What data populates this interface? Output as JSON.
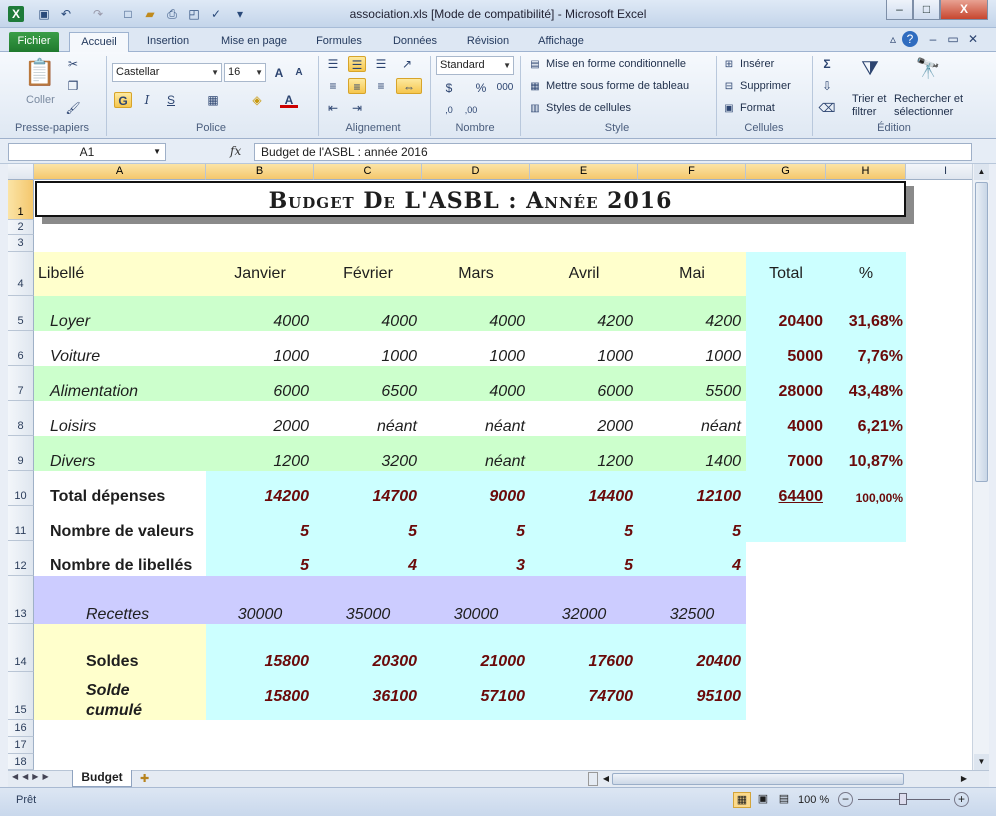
{
  "window": {
    "title": "association.xls  [Mode de compatibilité]  -  Microsoft Excel",
    "app_icon": "X",
    "minimize": "–",
    "restore": "□",
    "close": "X"
  },
  "ribbon_tabs": [
    "Fichier",
    "Accueil",
    "Insertion",
    "Mise en page",
    "Formules",
    "Données",
    "Révision",
    "Affichage"
  ],
  "ribbon": {
    "clipboard": {
      "paste": "Coller",
      "label": "Presse-papiers"
    },
    "font": {
      "name": "Castellar",
      "size": "16",
      "bold": "G",
      "italic": "I",
      "underline": "S",
      "label": "Police"
    },
    "alignment": {
      "label": "Alignement"
    },
    "number": {
      "format": "Standard",
      "currency": "$",
      "percent": "%",
      "thousands": "000",
      "label": "Nombre"
    },
    "style": {
      "conditional": "Mise en forme conditionnelle",
      "table": "Mettre sous forme de tableau",
      "cell_styles": "Styles de cellules",
      "label": "Style"
    },
    "cells": {
      "insert": "Insérer",
      "delete": "Supprimer",
      "format": "Format",
      "label": "Cellules"
    },
    "editing": {
      "sigma": "Σ",
      "sort_line1": "Trier et",
      "sort_line2": "filtrer",
      "find_line1": "Rechercher et",
      "find_line2": "sélectionner",
      "label": "Édition"
    }
  },
  "formula_bar": {
    "name_box": "A1",
    "fx": "fx",
    "content": "Budget de l'ASBL : année 2016"
  },
  "columns": [
    "A",
    "B",
    "C",
    "D",
    "E",
    "F",
    "G",
    "H",
    "I"
  ],
  "rows": [
    "1",
    "2",
    "3",
    "4",
    "5",
    "6",
    "7",
    "8",
    "9",
    "10",
    "11",
    "12",
    "13",
    "14",
    "15",
    "16",
    "17",
    "18"
  ],
  "sheet": {
    "title": "Budget de l'ASBL : année 2016",
    "header": {
      "label": "Libellé",
      "months": [
        "Janvier",
        "Février",
        "Mars",
        "Avril",
        "Mai"
      ],
      "total": "Total",
      "pct": "%"
    },
    "expenses": [
      {
        "label": "Loyer",
        "values": [
          "4000",
          "4000",
          "4000",
          "4200",
          "4200"
        ],
        "total": "20400",
        "pct": "31,68%"
      },
      {
        "label": "Voiture",
        "values": [
          "1000",
          "1000",
          "1000",
          "1000",
          "1000"
        ],
        "total": "5000",
        "pct": "7,76%"
      },
      {
        "label": "Alimentation",
        "values": [
          "6000",
          "6500",
          "4000",
          "6000",
          "5500"
        ],
        "total": "28000",
        "pct": "43,48%"
      },
      {
        "label": "Loisirs",
        "values": [
          "2000",
          "néant",
          "néant",
          "2000",
          "néant"
        ],
        "total": "4000",
        "pct": "6,21%"
      },
      {
        "label": "Divers",
        "values": [
          "1200",
          "3200",
          "néant",
          "1200",
          "1400"
        ],
        "total": "7000",
        "pct": "10,87%"
      }
    ],
    "total_depenses": {
      "label": "Total dépenses",
      "values": [
        "14200",
        "14700",
        "9000",
        "14400",
        "12100"
      ],
      "total": "64400",
      "pct": "100,00%"
    },
    "nb_valeurs": {
      "label": "Nombre de valeurs",
      "values": [
        "5",
        "5",
        "5",
        "5",
        "5"
      ]
    },
    "nb_libelles": {
      "label": "Nombre de libellés",
      "values": [
        "5",
        "4",
        "3",
        "5",
        "4"
      ]
    },
    "recettes": {
      "label": "Recettes",
      "values": [
        "30000",
        "35000",
        "30000",
        "32000",
        "32500"
      ]
    },
    "soldes": {
      "label": "Soldes",
      "values": [
        "15800",
        "20300",
        "21000",
        "17600",
        "20400"
      ]
    },
    "solde_cumule": {
      "label_line1": "Solde",
      "label_line2": "cumulé",
      "values": [
        "15800",
        "36100",
        "57100",
        "74700",
        "95100"
      ]
    }
  },
  "sheet_tabs": {
    "active": "Budget"
  },
  "status": {
    "ready": "Prêt",
    "zoom": "100 %"
  },
  "colors": {
    "yellow": "#ffffcc",
    "green": "#ccffcc",
    "cyan": "#ccffff",
    "lavender": "#ccccff",
    "dark_red": "#6b0a0a"
  }
}
